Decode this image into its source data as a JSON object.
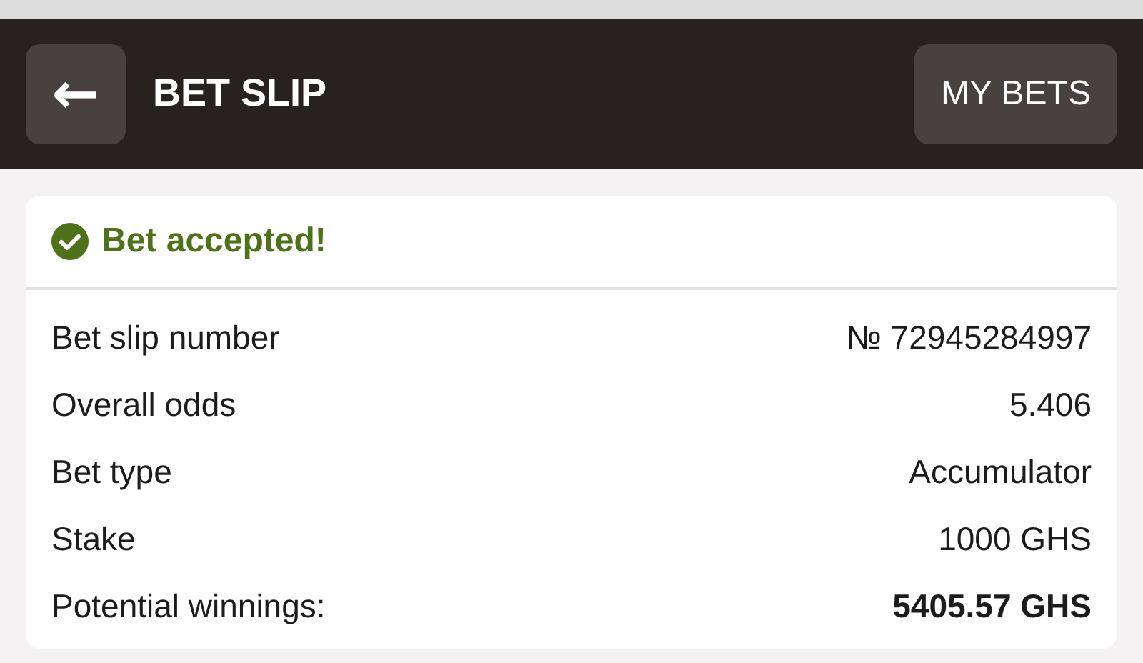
{
  "header": {
    "back_button": "←",
    "title": "BET SLIP",
    "my_bets_button": "MY BETS"
  },
  "status": {
    "message": "Bet accepted!",
    "kind": "success"
  },
  "details": [
    {
      "label": "Bet slip number",
      "value": "№ 72945284997",
      "emphasis": false
    },
    {
      "label": "Overall odds",
      "value": "5.406",
      "emphasis": false
    },
    {
      "label": "Bet type",
      "value": "Accumulator",
      "emphasis": false
    },
    {
      "label": "Stake",
      "value": "1000 GHS",
      "emphasis": false
    },
    {
      "label": "Potential winnings:",
      "value": "5405.57 GHS",
      "emphasis": true
    }
  ]
}
